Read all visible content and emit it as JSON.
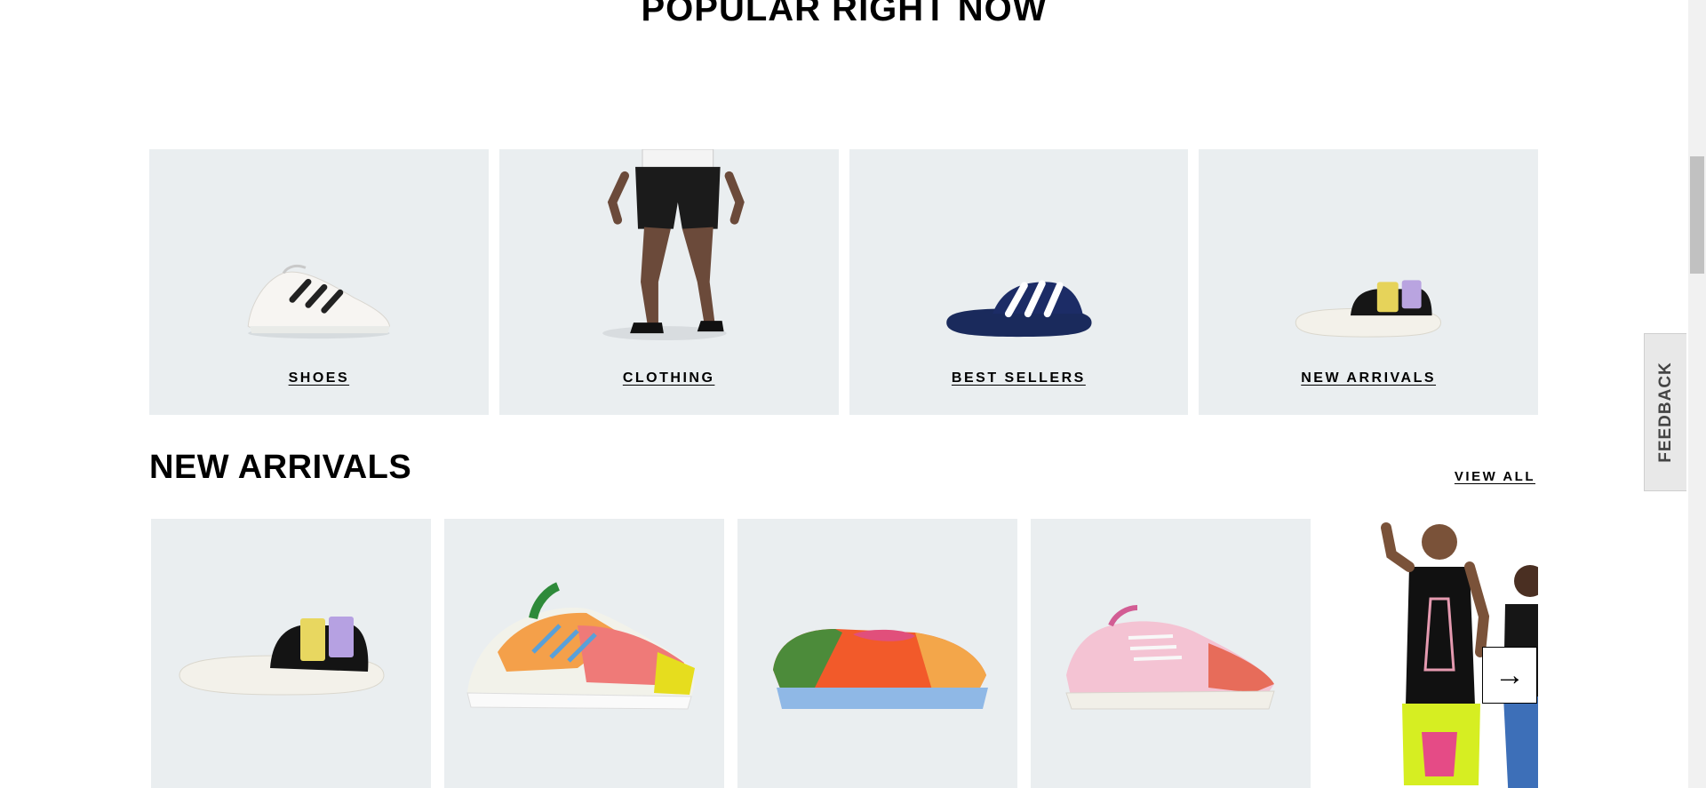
{
  "popular": {
    "title": "POPULAR RIGHT NOW",
    "categories": [
      {
        "label": "SHOES"
      },
      {
        "label": "CLOTHING"
      },
      {
        "label": "BEST SELLERS"
      },
      {
        "label": "NEW ARRIVALS"
      }
    ]
  },
  "new_arrivals": {
    "title": "NEW ARRIVALS",
    "view_all": "VIEW ALL",
    "next_icon": "arrow-right-icon"
  },
  "feedback": {
    "label": "FEEDBACK"
  },
  "colors": {
    "card_background": "#eaeef0",
    "text": "#000000",
    "scroll_thumb": "#c1c1c1"
  }
}
